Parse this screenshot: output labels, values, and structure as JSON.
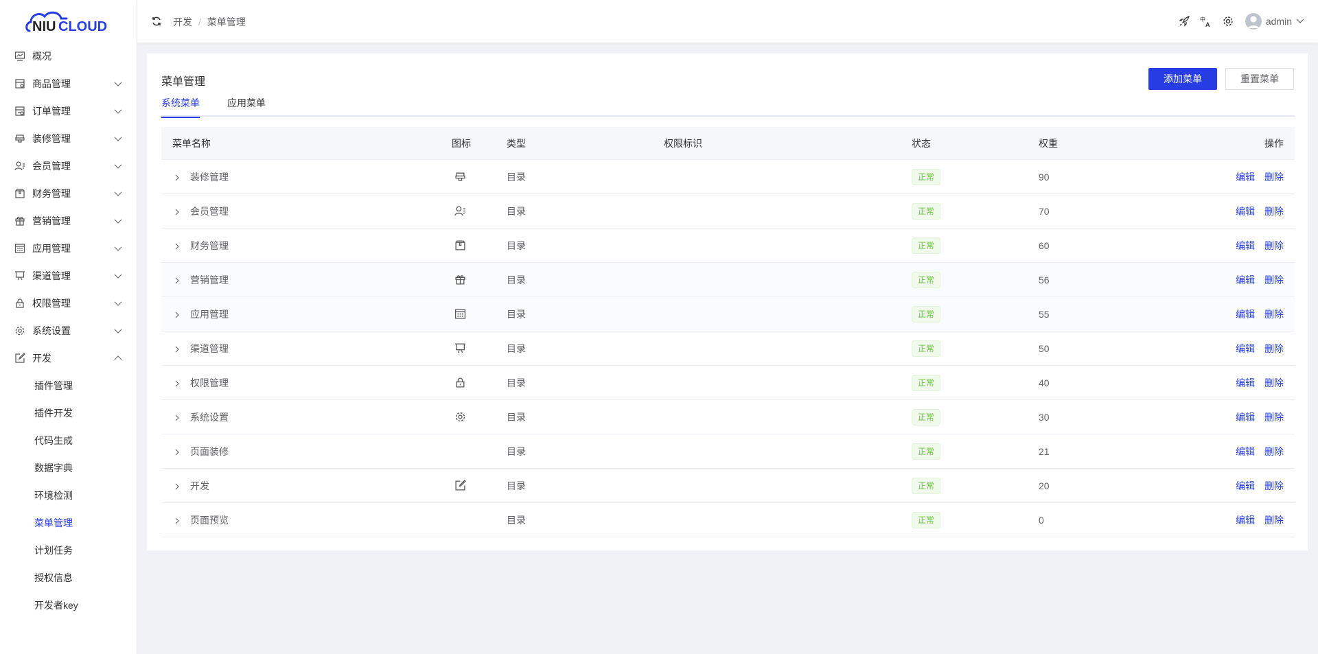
{
  "logo": {
    "text_dark": "NIU",
    "text_blue": "CLOUD"
  },
  "sidebar": {
    "items": [
      {
        "label": "概况",
        "icon": "chart-icon",
        "chevron": ""
      },
      {
        "label": "商品管理",
        "icon": "goods-icon",
        "chevron": "down"
      },
      {
        "label": "订单管理",
        "icon": "order-icon",
        "chevron": "down"
      },
      {
        "label": "装修管理",
        "icon": "decoration-icon",
        "chevron": "down"
      },
      {
        "label": "会员管理",
        "icon": "member-icon",
        "chevron": "down"
      },
      {
        "label": "财务管理",
        "icon": "finance-icon",
        "chevron": "down"
      },
      {
        "label": "营销管理",
        "icon": "gift-icon",
        "chevron": "down"
      },
      {
        "label": "应用管理",
        "icon": "app-icon",
        "chevron": "down"
      },
      {
        "label": "渠道管理",
        "icon": "channel-icon",
        "chevron": "down"
      },
      {
        "label": "权限管理",
        "icon": "lock-icon",
        "chevron": "down"
      },
      {
        "label": "系统设置",
        "icon": "gear-icon",
        "chevron": "down"
      },
      {
        "label": "开发",
        "icon": "edit-icon",
        "chevron": "up"
      }
    ],
    "sub_items": [
      {
        "label": "插件管理"
      },
      {
        "label": "插件开发"
      },
      {
        "label": "代码生成"
      },
      {
        "label": "数据字典"
      },
      {
        "label": "环境检测"
      },
      {
        "label": "菜单管理",
        "active": true
      },
      {
        "label": "计划任务"
      },
      {
        "label": "授权信息"
      },
      {
        "label": "开发者key"
      }
    ]
  },
  "header": {
    "breadcrumb": [
      "开发",
      "菜单管理"
    ],
    "breadcrumb_sep": "/",
    "username": "admin"
  },
  "page": {
    "title": "菜单管理",
    "add_button": "添加菜单",
    "reset_button": "重置菜单",
    "tabs": [
      {
        "label": "系统菜单",
        "active": true
      },
      {
        "label": "应用菜单",
        "active": false
      }
    ]
  },
  "table": {
    "columns": {
      "name": "菜单名称",
      "icon": "图标",
      "type": "类型",
      "perm": "权限标识",
      "status": "状态",
      "weight": "权重",
      "op": "操作"
    },
    "edit_label": "编辑",
    "delete_label": "删除",
    "rows": [
      {
        "name": "装修管理",
        "icon": "decoration-icon",
        "type": "目录",
        "perm": "",
        "status": "正常",
        "weight": "90"
      },
      {
        "name": "会员管理",
        "icon": "member-icon",
        "type": "目录",
        "perm": "",
        "status": "正常",
        "weight": "70"
      },
      {
        "name": "财务管理",
        "icon": "finance-icon",
        "type": "目录",
        "perm": "",
        "status": "正常",
        "weight": "60"
      },
      {
        "name": "营销管理",
        "icon": "gift-icon",
        "type": "目录",
        "perm": "",
        "status": "正常",
        "weight": "56",
        "shade": true
      },
      {
        "name": "应用管理",
        "icon": "app-icon",
        "type": "目录",
        "perm": "",
        "status": "正常",
        "weight": "55",
        "shade": true
      },
      {
        "name": "渠道管理",
        "icon": "channel-icon",
        "type": "目录",
        "perm": "",
        "status": "正常",
        "weight": "50"
      },
      {
        "name": "权限管理",
        "icon": "lock-icon",
        "type": "目录",
        "perm": "",
        "status": "正常",
        "weight": "40"
      },
      {
        "name": "系统设置",
        "icon": "gear-icon",
        "type": "目录",
        "perm": "",
        "status": "正常",
        "weight": "30"
      },
      {
        "name": "页面装修",
        "icon": "",
        "type": "目录",
        "perm": "",
        "status": "正常",
        "weight": "21"
      },
      {
        "name": "开发",
        "icon": "edit-icon",
        "type": "目录",
        "perm": "",
        "status": "正常",
        "weight": "20"
      },
      {
        "name": "页面预览",
        "icon": "",
        "type": "目录",
        "perm": "",
        "status": "正常",
        "weight": "0"
      }
    ]
  },
  "colors": {
    "primary": "#273de3",
    "success": "#67c23a"
  }
}
